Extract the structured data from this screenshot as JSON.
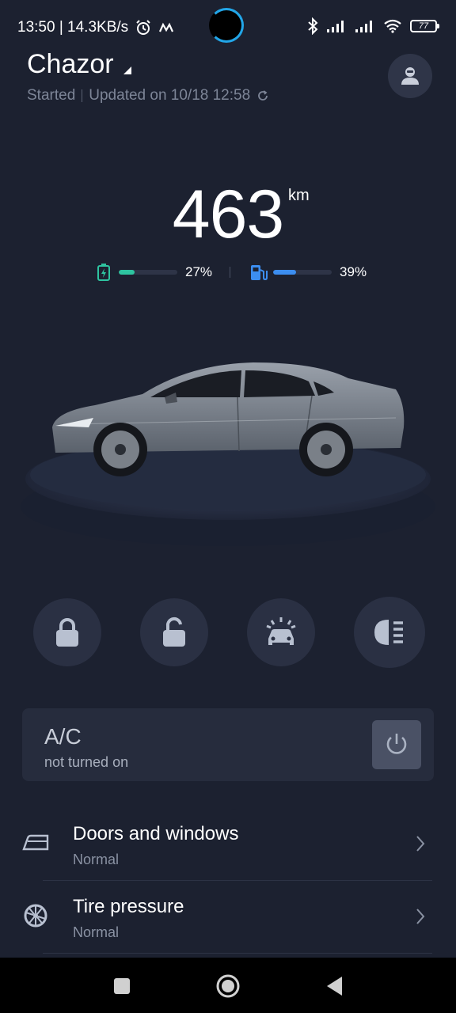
{
  "status_bar": {
    "time_speed": "13:50 | 14.3KB/s",
    "battery_level": "77"
  },
  "header": {
    "car_name": "Chazor",
    "status": "Started",
    "updated": "Updated on 10/18 12:58"
  },
  "range": {
    "value": "463",
    "unit": "km"
  },
  "levels": {
    "battery": {
      "percent_text": "27%",
      "fraction": 0.27,
      "color": "#2ec4a0"
    },
    "fuel": {
      "percent_text": "39%",
      "fraction": 0.39,
      "color": "#3c8ef0"
    }
  },
  "controls": [
    {
      "name": "lock-button",
      "icon": "lock-icon"
    },
    {
      "name": "unlock-button",
      "icon": "unlock-icon"
    },
    {
      "name": "find-car-button",
      "icon": "car-alarm-icon"
    },
    {
      "name": "headlight-button",
      "icon": "headlight-icon"
    }
  ],
  "ac": {
    "title": "A/C",
    "status": "not turned on"
  },
  "rows": [
    {
      "title": "Doors and windows",
      "status": "Normal",
      "icon": "car-door-icon"
    },
    {
      "title": "Tire pressure",
      "status": "Normal",
      "icon": "tire-icon"
    }
  ],
  "colors": {
    "background": "#1c2130",
    "card": "#262c3d",
    "accent_battery": "#2ec4a0",
    "accent_fuel": "#3c8ef0"
  }
}
